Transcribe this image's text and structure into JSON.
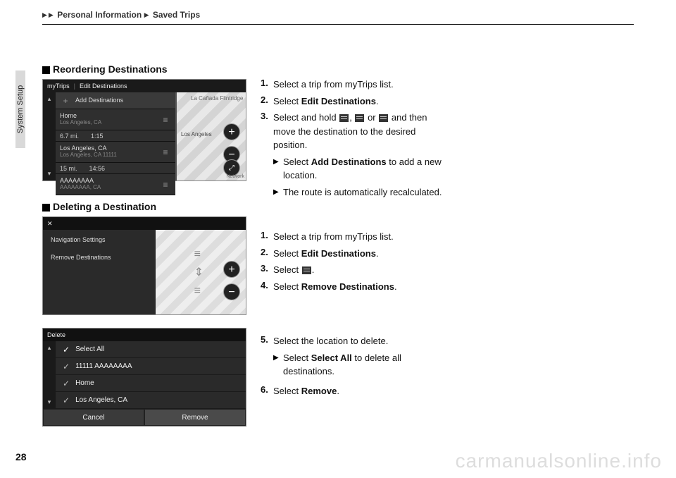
{
  "breadcrumb": {
    "level1": "Personal Information",
    "level2": "Saved Trips"
  },
  "sidetab": "System Setup",
  "page_number": "28",
  "watermark": "carmanualsonline.info",
  "section1": {
    "title": "Reordering Destinations",
    "screenshot": {
      "tabs": {
        "mytrips": "myTrips",
        "edit": "Edit Destinations"
      },
      "add": "Add Destinations",
      "rows": [
        {
          "name": "Home",
          "sub": "Los Angeles, CA"
        },
        {
          "dist": "6.7 mi.",
          "time": "1:15"
        },
        {
          "name": "Los Angeles, CA",
          "sub": "Los Angeles, CA 11111"
        },
        {
          "dist": "15 mi.",
          "time": "14:56"
        },
        {
          "name": "AAAAAAAA",
          "sub": "AAAAAAAA, CA"
        }
      ],
      "maplabels": {
        "top": "La Cañada Flintridge",
        "mid": "Los Angeles",
        "net": "Network"
      }
    },
    "steps": {
      "s1": "Select a trip from myTrips list.",
      "s2a": "Select ",
      "s2b": "Edit Destinations",
      "s2c": ".",
      "s3a": "Select and hold ",
      "s3b": ", ",
      "s3c": " or ",
      "s3d": " and then move the destination to the desired position.",
      "sub1a": "Select ",
      "sub1b": "Add Destinations",
      "sub1c": " to add a new location.",
      "sub2": "The route is automatically recalculated."
    }
  },
  "section2": {
    "title": "Deleting a Destination",
    "screenshot1": {
      "close": "✕",
      "navset": "Navigation Settings",
      "remdest": "Remove Destinations"
    },
    "screenshot2": {
      "title": "Delete",
      "selectall": "Select All",
      "row1": "11111 AAAAAAAA",
      "row2": "Home",
      "row3": "Los Angeles, CA",
      "cancel": "Cancel",
      "remove": "Remove"
    },
    "stepsA": {
      "s1": "Select a trip from myTrips list.",
      "s2a": "Select ",
      "s2b": "Edit Destinations",
      "s2c": ".",
      "s3a": "Select ",
      "s3b": ".",
      "s4a": "Select ",
      "s4b": "Remove Destinations",
      "s4c": "."
    },
    "stepsB": {
      "s5": "Select the location to delete.",
      "sub1a": "Select ",
      "sub1b": "Select All",
      "sub1c": " to delete all destinations.",
      "s6a": "Select ",
      "s6b": "Remove",
      "s6c": "."
    }
  }
}
